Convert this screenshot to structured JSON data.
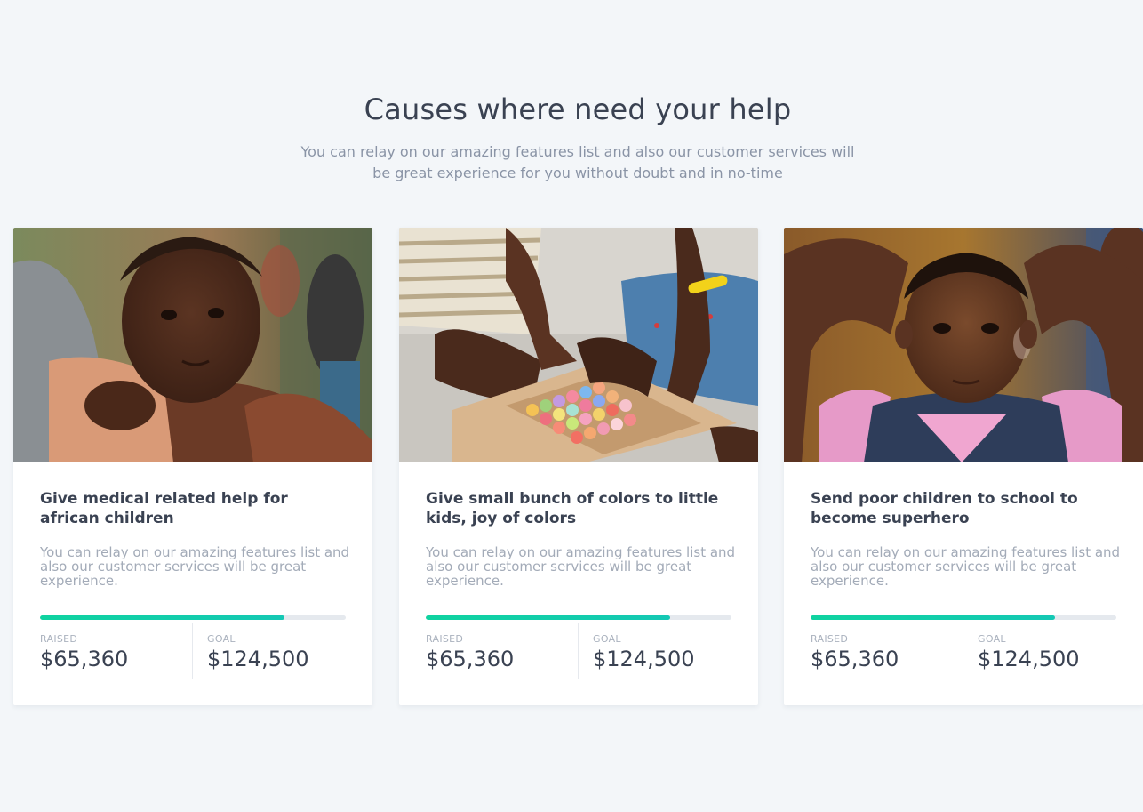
{
  "section": {
    "title": "Causes where need your help",
    "subtitle": "You can relay on our amazing features list and also our customer services will be great experience for you without doubt and in no-time"
  },
  "causes": [
    {
      "title": "Give medical related help for african children",
      "description": "You can relay on our amazing features list and also our customer services will be great experience.",
      "raised_label": "RAISED",
      "raised_value": "$65,360",
      "goal_label": "GOAL",
      "goal_value": "$124,500",
      "progress": 0.8
    },
    {
      "title": "Give small bunch of colors to little kids, joy of colors",
      "description": "You can relay on our amazing features list and also our customer services will be great experience.",
      "raised_label": "RAISED",
      "raised_value": "$65,360",
      "goal_label": "GOAL",
      "goal_value": "$124,500",
      "progress": 0.8
    },
    {
      "title": "Send poor children to school to become superhero",
      "description": "You can relay on our amazing features list and also our customer services will be great experience.",
      "raised_label": "RAISED",
      "raised_value": "$65,360",
      "goal_label": "GOAL",
      "goal_value": "$124,500",
      "progress": 0.8
    }
  ],
  "colors": {
    "background": "#f3f6f9",
    "heading": "#3a4252",
    "muted": "#8a94a6",
    "progress_accent": "#0fd3a0",
    "progress_track": "#e5e9ee"
  }
}
